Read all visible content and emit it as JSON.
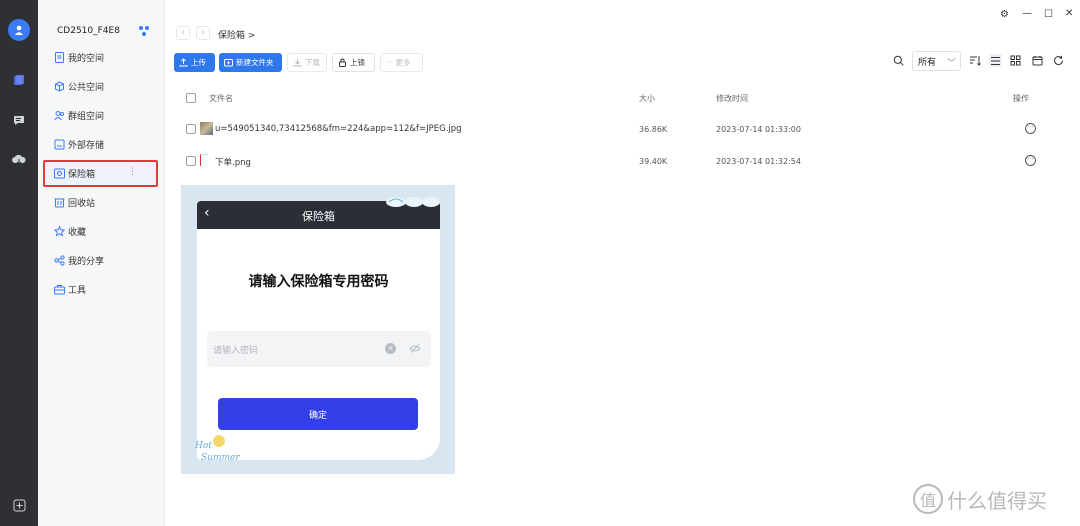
{
  "device": {
    "name": "CD2510_F4E8"
  },
  "sidebar": {
    "items": [
      {
        "label": "我的空间",
        "icon": "document-icon"
      },
      {
        "label": "公共空间",
        "icon": "cube-icon"
      },
      {
        "label": "群组空间",
        "icon": "group-icon"
      },
      {
        "label": "外部存储",
        "icon": "storage-icon"
      },
      {
        "label": "保险箱",
        "icon": "safe-icon",
        "active": true
      },
      {
        "label": "回收站",
        "icon": "trash-icon"
      },
      {
        "label": "收藏",
        "icon": "star-icon"
      },
      {
        "label": "我的分享",
        "icon": "share-icon"
      },
      {
        "label": "工具",
        "icon": "toolbox-icon"
      }
    ]
  },
  "breadcrumb": {
    "text": "保险箱 >"
  },
  "toolbar": {
    "upload": "上传",
    "new_folder": "新建文件夹",
    "download": "下载",
    "lock": "上锁",
    "more": "··· 更多"
  },
  "filter": {
    "selected": "所有"
  },
  "table": {
    "headers": {
      "name": "文件名",
      "size": "大小",
      "modified": "修改时间",
      "actions": "操作"
    },
    "rows": [
      {
        "name": "u=549051340,73412568&fm=224&app=112&f=JPEG.jpg",
        "size": "36.86K",
        "modified": "2023-07-14 01:33:00"
      },
      {
        "name": "下单.png",
        "size": "39.40K",
        "modified": "2023-07-14 01:32:54"
      }
    ]
  },
  "preview": {
    "title": "保险箱",
    "heading": "请输入保险箱专用密码",
    "placeholder": "请输入密码",
    "confirm": "确定",
    "sticker_line1": "Hot",
    "sticker_line2": "Summer"
  },
  "watermark": {
    "text": "什么值得买",
    "logo": "值"
  },
  "colors": {
    "accent": "#2f78ec",
    "rail": "#2f3033",
    "highlight": "#e23a3a",
    "confirm": "#3340e8"
  }
}
